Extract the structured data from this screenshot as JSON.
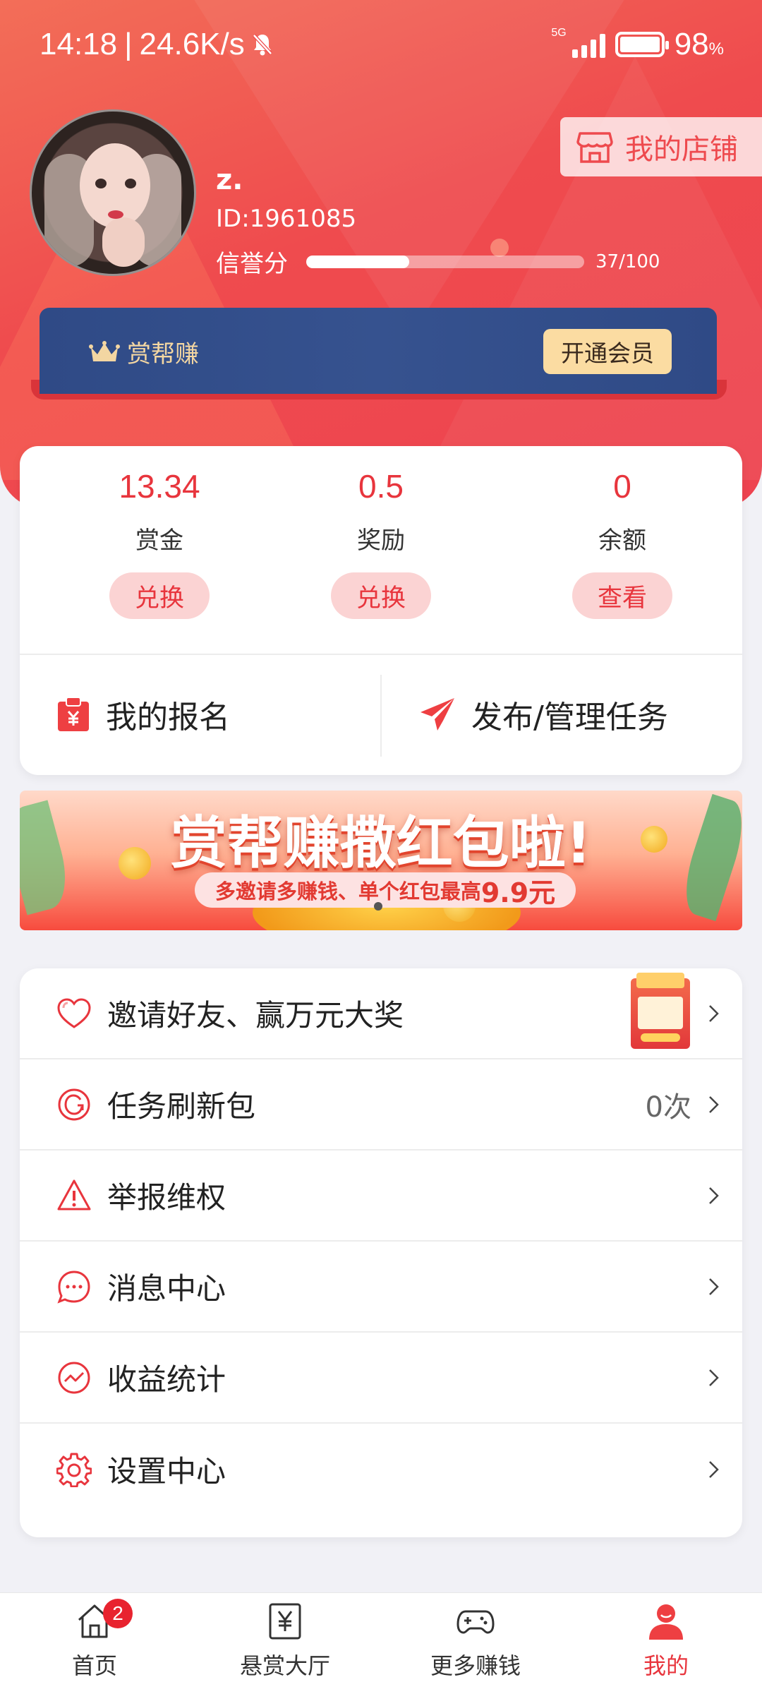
{
  "status_bar": {
    "time": "14:18",
    "separator": "|",
    "net_speed": "24.6K/s",
    "network": "5G",
    "battery": "98",
    "battery_unit": "%"
  },
  "profile": {
    "name": "z.",
    "id": "ID:1961085",
    "credit_label": "信誉分",
    "credit_value": 37,
    "credit_max": 100,
    "credit_text": "37/100",
    "my_store": "我的店铺"
  },
  "vip": {
    "brand": "赏帮赚",
    "button": "开通会员"
  },
  "stats": [
    {
      "value": "13.34",
      "label": "赏金",
      "button": "兑换"
    },
    {
      "value": "0.5",
      "label": "奖励",
      "button": "兑换"
    },
    {
      "value": "0",
      "label": "余额",
      "button": "查看"
    }
  ],
  "actions": {
    "my_signup": "我的报名",
    "publish": "发布/管理任务"
  },
  "promo": {
    "title": "赏帮赚撒红包啦!",
    "subtitle_prefix": "多邀请多赚钱、单个红包最高",
    "subtitle_amount": "9.9元"
  },
  "menu": [
    {
      "label": "邀请好友、赢万元大奖",
      "value": "",
      "icon": "heart-icon"
    },
    {
      "label": "任务刷新包",
      "value": "0次",
      "icon": "refresh-icon"
    },
    {
      "label": "举报维权",
      "value": "",
      "icon": "warning-icon"
    },
    {
      "label": "消息中心",
      "value": "",
      "icon": "message-icon"
    },
    {
      "label": "收益统计",
      "value": "",
      "icon": "chart-icon"
    },
    {
      "label": "设置中心",
      "value": "",
      "icon": "gear-icon"
    }
  ],
  "bottom_nav": {
    "home": "首页",
    "home_badge": "2",
    "hall": "悬赏大厅",
    "more": "更多赚钱",
    "mine": "我的"
  },
  "colors": {
    "brand_red": "#e8353d",
    "vip_blue": "#2f4a86",
    "vip_gold": "#fbdca2"
  }
}
